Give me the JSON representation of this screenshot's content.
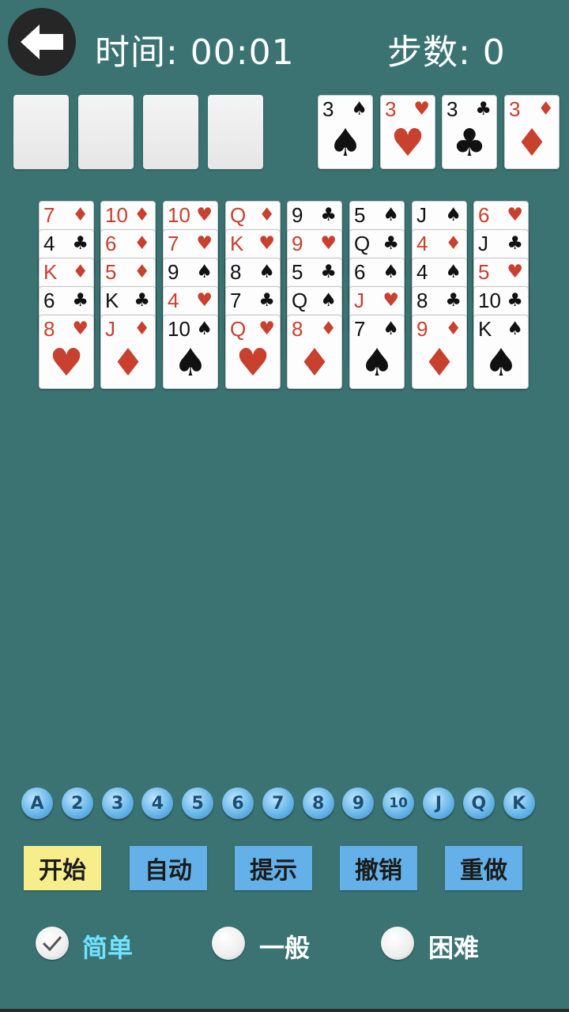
{
  "header": {
    "time_label": "时间: 00:01",
    "steps_label": "步数: 0",
    "back_icon": "back-arrow-icon"
  },
  "free_cells": [
    "",
    "",
    "",
    ""
  ],
  "foundations": [
    {
      "rank": "3",
      "suit": "♠",
      "color": "blk"
    },
    {
      "rank": "3",
      "suit": "♥",
      "color": "red"
    },
    {
      "rank": "3",
      "suit": "♣",
      "color": "blk"
    },
    {
      "rank": "3",
      "suit": "♦",
      "color": "red"
    }
  ],
  "tableau": [
    [
      {
        "rank": "7",
        "suit": "♦",
        "color": "red"
      },
      {
        "rank": "4",
        "suit": "♣",
        "color": "blk"
      },
      {
        "rank": "K",
        "suit": "♦",
        "color": "red"
      },
      {
        "rank": "6",
        "suit": "♣",
        "color": "blk"
      },
      {
        "rank": "8",
        "suit": "♥",
        "color": "red"
      }
    ],
    [
      {
        "rank": "10",
        "suit": "♦",
        "color": "red"
      },
      {
        "rank": "6",
        "suit": "♦",
        "color": "red"
      },
      {
        "rank": "5",
        "suit": "♦",
        "color": "red"
      },
      {
        "rank": "K",
        "suit": "♣",
        "color": "blk"
      },
      {
        "rank": "J",
        "suit": "♦",
        "color": "red"
      }
    ],
    [
      {
        "rank": "10",
        "suit": "♥",
        "color": "red"
      },
      {
        "rank": "7",
        "suit": "♥",
        "color": "red"
      },
      {
        "rank": "9",
        "suit": "♠",
        "color": "blk"
      },
      {
        "rank": "4",
        "suit": "♥",
        "color": "red"
      },
      {
        "rank": "10",
        "suit": "♠",
        "color": "blk"
      }
    ],
    [
      {
        "rank": "Q",
        "suit": "♦",
        "color": "red"
      },
      {
        "rank": "K",
        "suit": "♥",
        "color": "red"
      },
      {
        "rank": "8",
        "suit": "♠",
        "color": "blk"
      },
      {
        "rank": "7",
        "suit": "♣",
        "color": "blk"
      },
      {
        "rank": "Q",
        "suit": "♥",
        "color": "red"
      }
    ],
    [
      {
        "rank": "9",
        "suit": "♣",
        "color": "blk"
      },
      {
        "rank": "9",
        "suit": "♥",
        "color": "red"
      },
      {
        "rank": "5",
        "suit": "♣",
        "color": "blk"
      },
      {
        "rank": "Q",
        "suit": "♠",
        "color": "blk"
      },
      {
        "rank": "8",
        "suit": "♦",
        "color": "red"
      }
    ],
    [
      {
        "rank": "5",
        "suit": "♠",
        "color": "blk"
      },
      {
        "rank": "Q",
        "suit": "♣",
        "color": "blk"
      },
      {
        "rank": "6",
        "suit": "♠",
        "color": "blk"
      },
      {
        "rank": "J",
        "suit": "♥",
        "color": "red"
      },
      {
        "rank": "7",
        "suit": "♠",
        "color": "blk"
      }
    ],
    [
      {
        "rank": "J",
        "suit": "♠",
        "color": "blk"
      },
      {
        "rank": "4",
        "suit": "♦",
        "color": "red"
      },
      {
        "rank": "4",
        "suit": "♠",
        "color": "blk"
      },
      {
        "rank": "8",
        "suit": "♣",
        "color": "blk"
      },
      {
        "rank": "9",
        "suit": "♦",
        "color": "red"
      }
    ],
    [
      {
        "rank": "6",
        "suit": "♥",
        "color": "red"
      },
      {
        "rank": "J",
        "suit": "♣",
        "color": "blk"
      },
      {
        "rank": "5",
        "suit": "♥",
        "color": "red"
      },
      {
        "rank": "10",
        "suit": "♣",
        "color": "blk"
      },
      {
        "rank": "K",
        "suit": "♠",
        "color": "blk"
      }
    ]
  ],
  "ranks": [
    "A",
    "2",
    "3",
    "4",
    "5",
    "6",
    "7",
    "8",
    "9",
    "10",
    "J",
    "Q",
    "K"
  ],
  "buttons": {
    "start": "开始",
    "auto": "自动",
    "hint": "提示",
    "undo": "撤销",
    "redo": "重做"
  },
  "difficulty": {
    "easy": "简单",
    "normal": "一般",
    "hard": "困难",
    "selected": "easy"
  },
  "colors": {
    "felt": "#3b7373",
    "button": "#63b1e8",
    "start_button": "#f7ed8b",
    "selected_label": "#6fe3ff",
    "red_suit": "#c8402e"
  }
}
